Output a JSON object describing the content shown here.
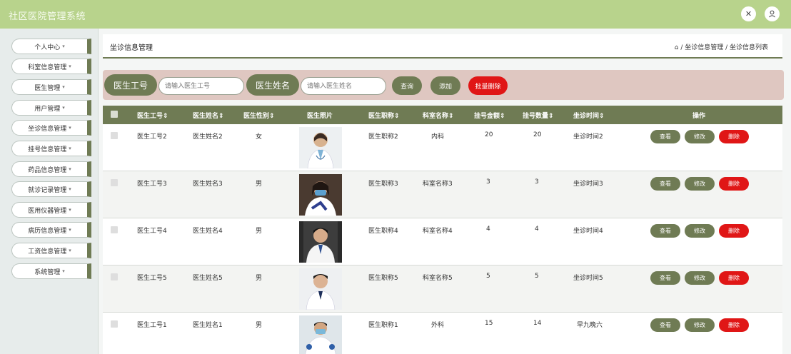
{
  "app": {
    "title": "社区医院管理系统"
  },
  "topbar": {
    "fullscreen_icon": "expand-icon",
    "user_icon": "user-icon"
  },
  "sidebar": {
    "items": [
      {
        "label": "个人中心"
      },
      {
        "label": "科室信息管理"
      },
      {
        "label": "医生管理"
      },
      {
        "label": "用户管理"
      },
      {
        "label": "坐诊信息管理"
      },
      {
        "label": "挂号信息管理"
      },
      {
        "label": "药品信息管理"
      },
      {
        "label": "就诊记录管理"
      },
      {
        "label": "医用仪器管理"
      },
      {
        "label": "病历信息管理"
      },
      {
        "label": "工资信息管理"
      },
      {
        "label": "系统管理"
      }
    ],
    "caret": "▾"
  },
  "page": {
    "title": "坐诊信息管理",
    "breadcrumb": "⌂ / 坐诊信息管理 / 坐诊信息列表"
  },
  "search": {
    "doctor_id_label": "医生工号",
    "doctor_id_placeholder": "请输入医生工号",
    "doctor_name_label": "医生姓名",
    "doctor_name_placeholder": "请输入医生姓名",
    "query_btn": "查询",
    "add_btn": "添加",
    "batch_delete_btn": "批量删除"
  },
  "table": {
    "headers": {
      "doctor_id": "医生工号⇕",
      "doctor_name": "医生姓名⇕",
      "gender": "医生性别⇕",
      "photo": "医生照片",
      "title": "医生职称⇕",
      "dept": "科室名称⇕",
      "fee": "挂号金额⇕",
      "count": "挂号数量⇕",
      "time": "坐诊时间⇕",
      "ops": "操作"
    },
    "rows": [
      {
        "doctor_id": "医生工号2",
        "doctor_name": "医生姓名2",
        "gender": "女",
        "title": "医生职称2",
        "dept": "内科",
        "fee": "20",
        "count": "20",
        "time": "坐诊时间2"
      },
      {
        "doctor_id": "医生工号3",
        "doctor_name": "医生姓名3",
        "gender": "男",
        "title": "医生职称3",
        "dept": "科室名称3",
        "fee": "3",
        "count": "3",
        "time": "坐诊时间3"
      },
      {
        "doctor_id": "医生工号4",
        "doctor_name": "医生姓名4",
        "gender": "男",
        "title": "医生职称4",
        "dept": "科室名称4",
        "fee": "4",
        "count": "4",
        "time": "坐诊时间4"
      },
      {
        "doctor_id": "医生工号5",
        "doctor_name": "医生姓名5",
        "gender": "男",
        "title": "医生职称5",
        "dept": "科室名称5",
        "fee": "5",
        "count": "5",
        "time": "坐诊时间5"
      },
      {
        "doctor_id": "医生工号1",
        "doctor_name": "医生姓名1",
        "gender": "男",
        "title": "医生职称1",
        "dept": "外科",
        "fee": "15",
        "count": "14",
        "time": "早九晚六"
      }
    ],
    "actions": {
      "view": "查看",
      "edit": "修改",
      "delete": "删除"
    }
  },
  "colors": {
    "olive": "#6f7b54",
    "green_top": "#b8d38c",
    "red": "#e01616",
    "search_bg": "#dfc7c1"
  }
}
